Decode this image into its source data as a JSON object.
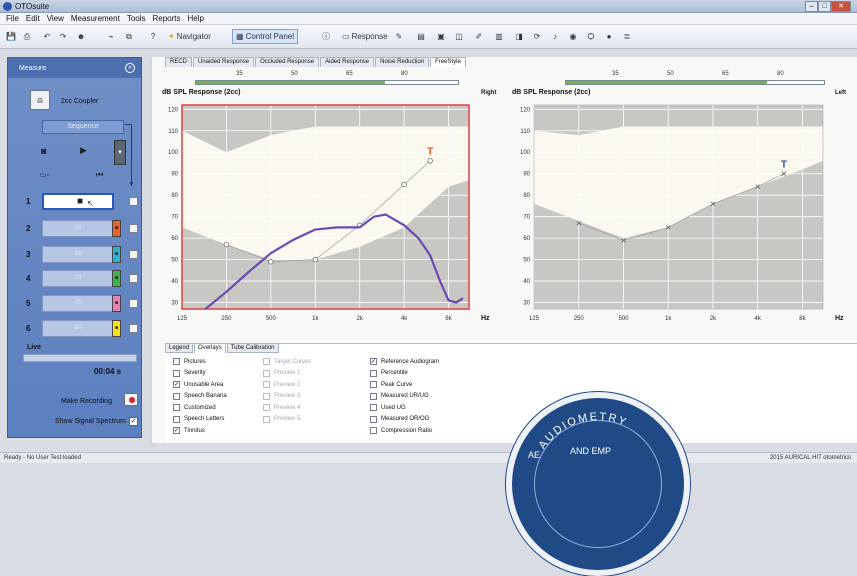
{
  "window": {
    "title": "OTOsuite",
    "btn_min": "–",
    "btn_max": "□",
    "btn_close": "✕"
  },
  "menu": [
    "File",
    "Edit",
    "View",
    "Measurement",
    "Tools",
    "Reports",
    "Help"
  ],
  "toolbar": {
    "navigator_label": "Navigator",
    "control_panel_label": "Control Panel",
    "response_label": "Response"
  },
  "side_panel": {
    "title": "Measure",
    "collapse": "«",
    "coupler_label": "2cc Coupler",
    "sequence_label": "Sequence",
    "play_symbol": "▶",
    "dropdown_symbol": "▾",
    "rows": [
      {
        "num": "1",
        "text": "",
        "color": "#ffffff",
        "icon": "■"
      },
      {
        "num": "2",
        "text": "60",
        "color": "#e8632c",
        "icon": "■"
      },
      {
        "num": "3",
        "text": "65",
        "color": "#2bb3cf",
        "icon": "■"
      },
      {
        "num": "4",
        "text": "70",
        "color": "#3db54a",
        "icon": "■"
      },
      {
        "num": "5",
        "text": "75",
        "color": "#e97fb8",
        "icon": "■"
      },
      {
        "num": "6",
        "text": "80",
        "color": "#f3e21c",
        "icon": "■"
      }
    ],
    "live_label": "Live",
    "timer": "00:04 s",
    "make_recording_label": "Make Recording",
    "show_signal_label": "Show Signal Spectrum",
    "show_signal_checked": "✓"
  },
  "tabs": [
    "RECD",
    "Unaided Response",
    "Occluded Response",
    "Aided Response",
    "Noise Reduction",
    "FreeStyle"
  ],
  "active_tab": "FreeStyle",
  "meters": {
    "ticks": [
      "35",
      "50",
      "65",
      "80"
    ],
    "right_ear_fill_fraction": 0.72,
    "left_ear_fill_fraction": 0.78
  },
  "chart_data": [
    {
      "type": "line",
      "title": "dB SPL Response (2cc)",
      "side_label": "Right",
      "xlabel": "Hz",
      "x_ticks": [
        "125",
        "250",
        "500",
        "1k",
        "2k",
        "4k",
        "8k"
      ],
      "y_ticks": [
        30,
        40,
        50,
        60,
        70,
        80,
        90,
        100,
        110,
        120
      ],
      "ylim": [
        27,
        122
      ],
      "grid": true,
      "highlighted": true,
      "target_marker_label": "T",
      "colors": {
        "curve": "#6b4bb0",
        "target": "#e5532a",
        "shade": "#c7c7c4",
        "frame": "#e04141"
      },
      "shaded_lower_boundary": {
        "x": [
          125,
          250,
          500,
          1000,
          2000,
          4000,
          8000,
          11000
        ],
        "y": [
          65,
          57,
          50,
          50,
          56,
          65,
          84,
          87
        ]
      },
      "shaded_upper_boundary": {
        "x": [
          125,
          250,
          500,
          1000,
          2000,
          4000,
          8000,
          11000
        ],
        "y": [
          110,
          100,
          108,
          112,
          112,
          112,
          112,
          112
        ]
      },
      "marker_points": {
        "x": [
          250,
          500,
          1000,
          2000,
          4000,
          6000
        ],
        "y": [
          57,
          49,
          50,
          66,
          85,
          96
        ]
      },
      "target": {
        "x": 6000,
        "y": 99
      },
      "series": [
        {
          "x": [
            180,
            250,
            350,
            500,
            700,
            1000,
            1400,
            2000,
            2500,
            3000,
            4000,
            5000,
            6000,
            7000,
            8000,
            9000,
            10000
          ],
          "y": [
            27,
            35,
            44,
            53,
            59,
            64,
            65,
            65,
            70,
            71,
            66,
            60,
            52,
            40,
            31,
            30,
            32
          ]
        }
      ]
    },
    {
      "type": "line",
      "title": "dB SPL Response (2cc)",
      "side_label": "Left",
      "xlabel": "Hz",
      "x_ticks": [
        "125",
        "250",
        "500",
        "1k",
        "2k",
        "4k",
        "8k"
      ],
      "y_ticks": [
        30,
        40,
        50,
        60,
        70,
        80,
        90,
        100,
        110,
        120
      ],
      "ylim": [
        27,
        122
      ],
      "grid": true,
      "highlighted": false,
      "target_marker_label": "T",
      "colors": {
        "target": "#2c4fa3",
        "shade": "#c7c7c4"
      },
      "shaded_lower_boundary": {
        "x": [
          125,
          250,
          500,
          1000,
          2000,
          4000,
          8000,
          11000
        ],
        "y": [
          76,
          68,
          60,
          65,
          76,
          84,
          92,
          96
        ]
      },
      "shaded_upper_boundary": {
        "x": [
          125,
          250,
          500,
          1000,
          2000,
          4000,
          8000,
          11000
        ],
        "y": [
          110,
          108,
          112,
          112,
          112,
          112,
          112,
          112
        ]
      },
      "marker_points": {
        "x": [
          250,
          500,
          1000,
          2000,
          4000,
          6000
        ],
        "y": [
          67,
          59,
          65,
          76,
          84,
          90
        ]
      },
      "target": {
        "x": 6000,
        "y": 93
      },
      "series": []
    }
  ],
  "lower_tabs": [
    "Legend",
    "Overlays",
    "Tube Calibration"
  ],
  "active_lower_tab": "Overlays",
  "overlays": {
    "col1": [
      {
        "label": "Pictures",
        "checked": ""
      },
      {
        "label": "Severity",
        "checked": ""
      },
      {
        "label": "Unusable Area",
        "checked": "✓"
      },
      {
        "label": "Speech Banana",
        "checked": ""
      },
      {
        "label": "Customized",
        "checked": ""
      },
      {
        "label": "Speech Letters",
        "checked": ""
      },
      {
        "label": "Tinnitus",
        "checked": "✓"
      }
    ],
    "col2": [
      {
        "label": "Target Curves",
        "checked": ""
      },
      {
        "label": "Preview 1",
        "checked": ""
      },
      {
        "label": "Preview 2",
        "checked": ""
      },
      {
        "label": "Preview 3",
        "checked": ""
      },
      {
        "label": "Preview 4",
        "checked": ""
      },
      {
        "label": "Preview 5",
        "checked": ""
      }
    ],
    "col3": [
      {
        "label": "Reference Audiogram",
        "checked": "✓"
      },
      {
        "label": "Percentile",
        "checked": ""
      },
      {
        "label": "Peak Curve",
        "checked": ""
      },
      {
        "label": "Measured UR/UG",
        "checked": ""
      },
      {
        "label": "Used UG",
        "checked": ""
      },
      {
        "label": "Measured OR/OG",
        "checked": ""
      },
      {
        "label": "Compression Ratio",
        "checked": ""
      }
    ]
  },
  "status": {
    "left": "Ready - No User Test loaded",
    "right": "2015 AURICAL HIT  otometrics"
  },
  "seal": {
    "text1": "AUDIOMETRY",
    "text2": "AE",
    "text3": "AND EMP"
  }
}
